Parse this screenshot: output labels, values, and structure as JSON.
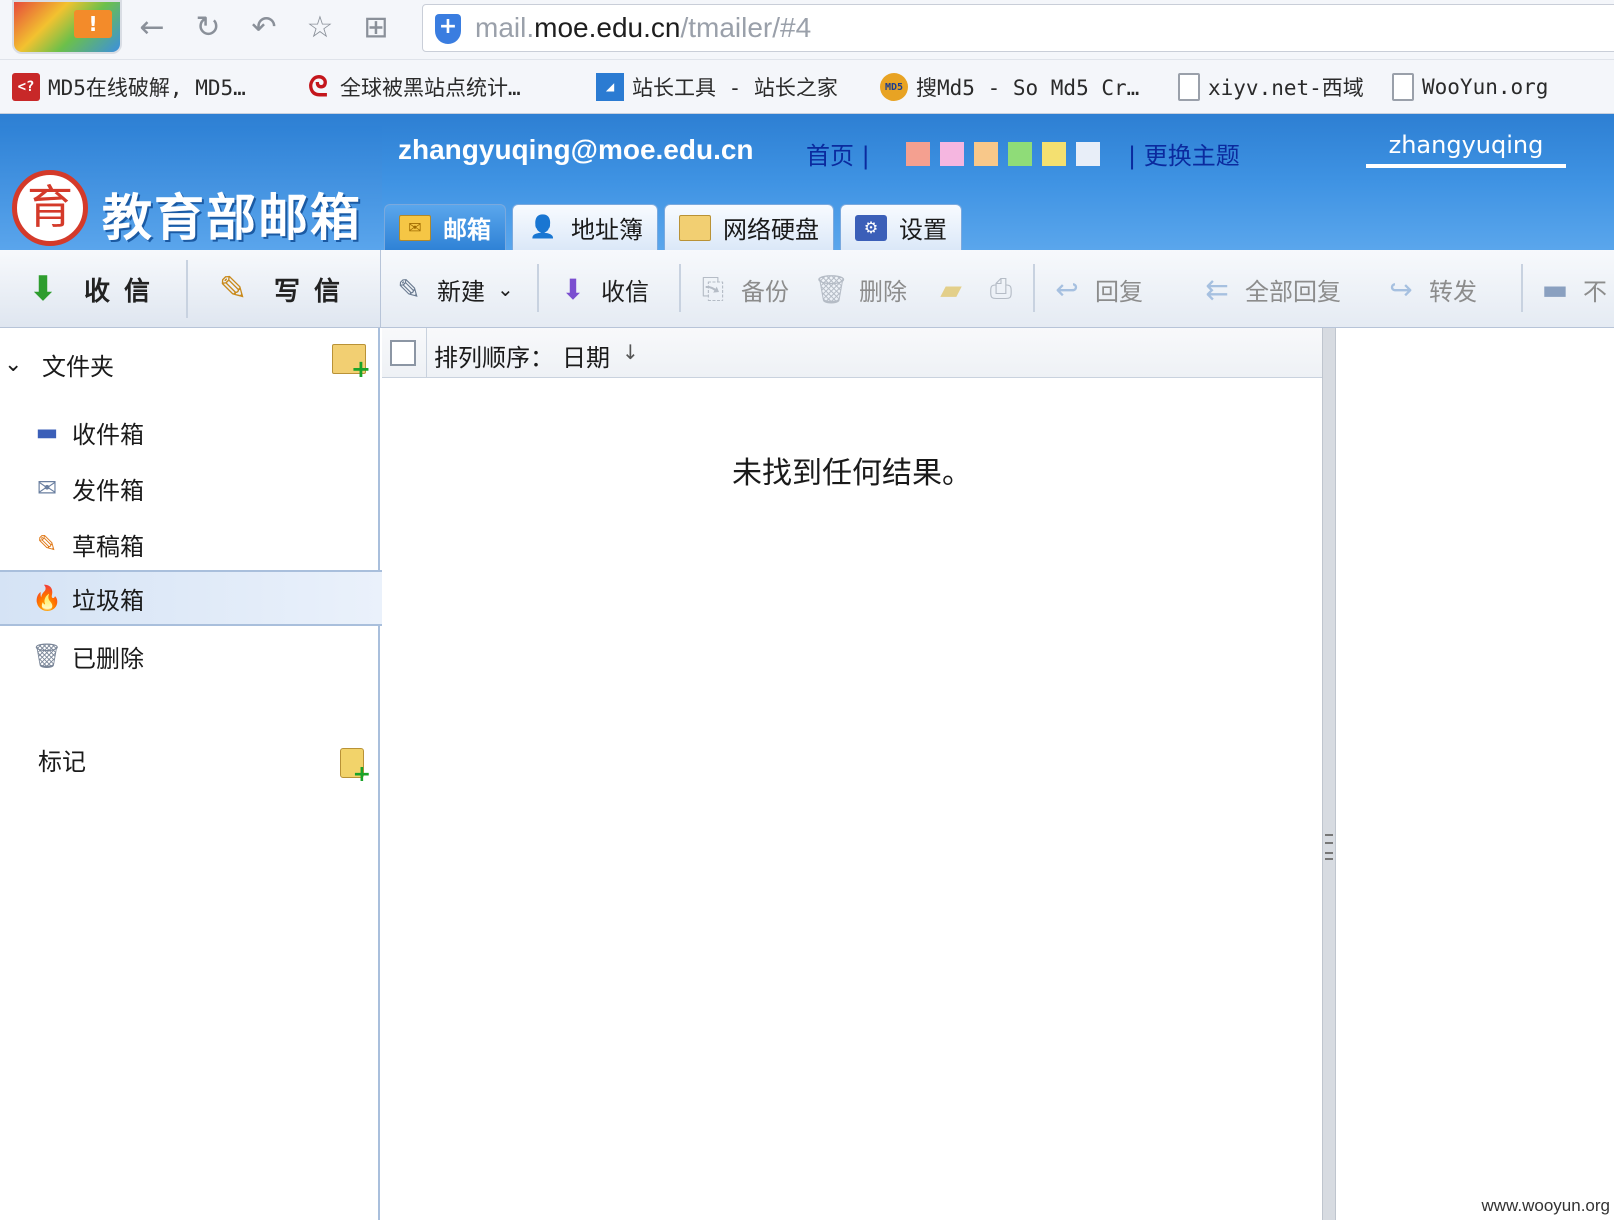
{
  "browser": {
    "logo_badge": "!",
    "url_prefix": "mail.",
    "url_host": "moe.edu.cn",
    "url_path": "/tmailer/#4",
    "nav_icons": [
      "back-icon",
      "refresh-icon",
      "undo-icon",
      "star-icon",
      "apps-icon"
    ]
  },
  "bookmarks": [
    {
      "label": "MD5在线破解, MD5…",
      "icon": "<?"
    },
    {
      "label": "全球被黑站点统计…",
      "icon": ""
    },
    {
      "label": "站长工具 - 站长之家",
      "icon": ""
    },
    {
      "label": "搜Md5 - So Md5 Cr…",
      "icon": "MD5"
    },
    {
      "label": "xiyv.net-西域",
      "icon": ""
    },
    {
      "label": "WooYun.org",
      "icon": ""
    }
  ],
  "header": {
    "logo_seal": "育",
    "logo_text": "教育部邮箱",
    "user_email": "zhangyuqing@moe.edu.cn",
    "home_link": "首页 |",
    "theme_link": "| 更换主题",
    "username": "zhangyuqing",
    "theme_colors": [
      "#f4a090",
      "#f5b6e0",
      "#f8c88a",
      "#8fdc78",
      "#f4e070",
      "#e8eef8"
    ]
  },
  "tabs": [
    {
      "label": "邮箱",
      "icon": "mail-icon",
      "active": true
    },
    {
      "label": "地址簿",
      "icon": "contacts-icon",
      "active": false
    },
    {
      "label": "网络硬盘",
      "icon": "folder-icon",
      "active": false
    },
    {
      "label": "设置",
      "icon": "settings-icon",
      "active": false
    }
  ],
  "actions": {
    "receive": "收信",
    "compose": "写信"
  },
  "toolbar": {
    "new": "新建",
    "receive": "收信",
    "backup": "备份",
    "delete": "删除",
    "reply": "回复",
    "reply_all": "全部回复",
    "forward": "转发",
    "more": "不"
  },
  "sidebar": {
    "folders_title": "文件夹",
    "folders": [
      {
        "label": "收件箱",
        "icon": "inbox-icon",
        "selected": false
      },
      {
        "label": "发件箱",
        "icon": "outbox-icon",
        "selected": false
      },
      {
        "label": "草稿箱",
        "icon": "drafts-icon",
        "selected": false
      },
      {
        "label": "垃圾箱",
        "icon": "spam-icon",
        "selected": true
      },
      {
        "label": "已删除",
        "icon": "trash-icon",
        "selected": false
      }
    ],
    "tags_title": "标记"
  },
  "list": {
    "sort_label": "排列顺序：",
    "sort_value": "日期",
    "sort_arrow": "↓",
    "empty_message": "未找到任何结果。"
  },
  "watermark": "www.wooyun.org"
}
